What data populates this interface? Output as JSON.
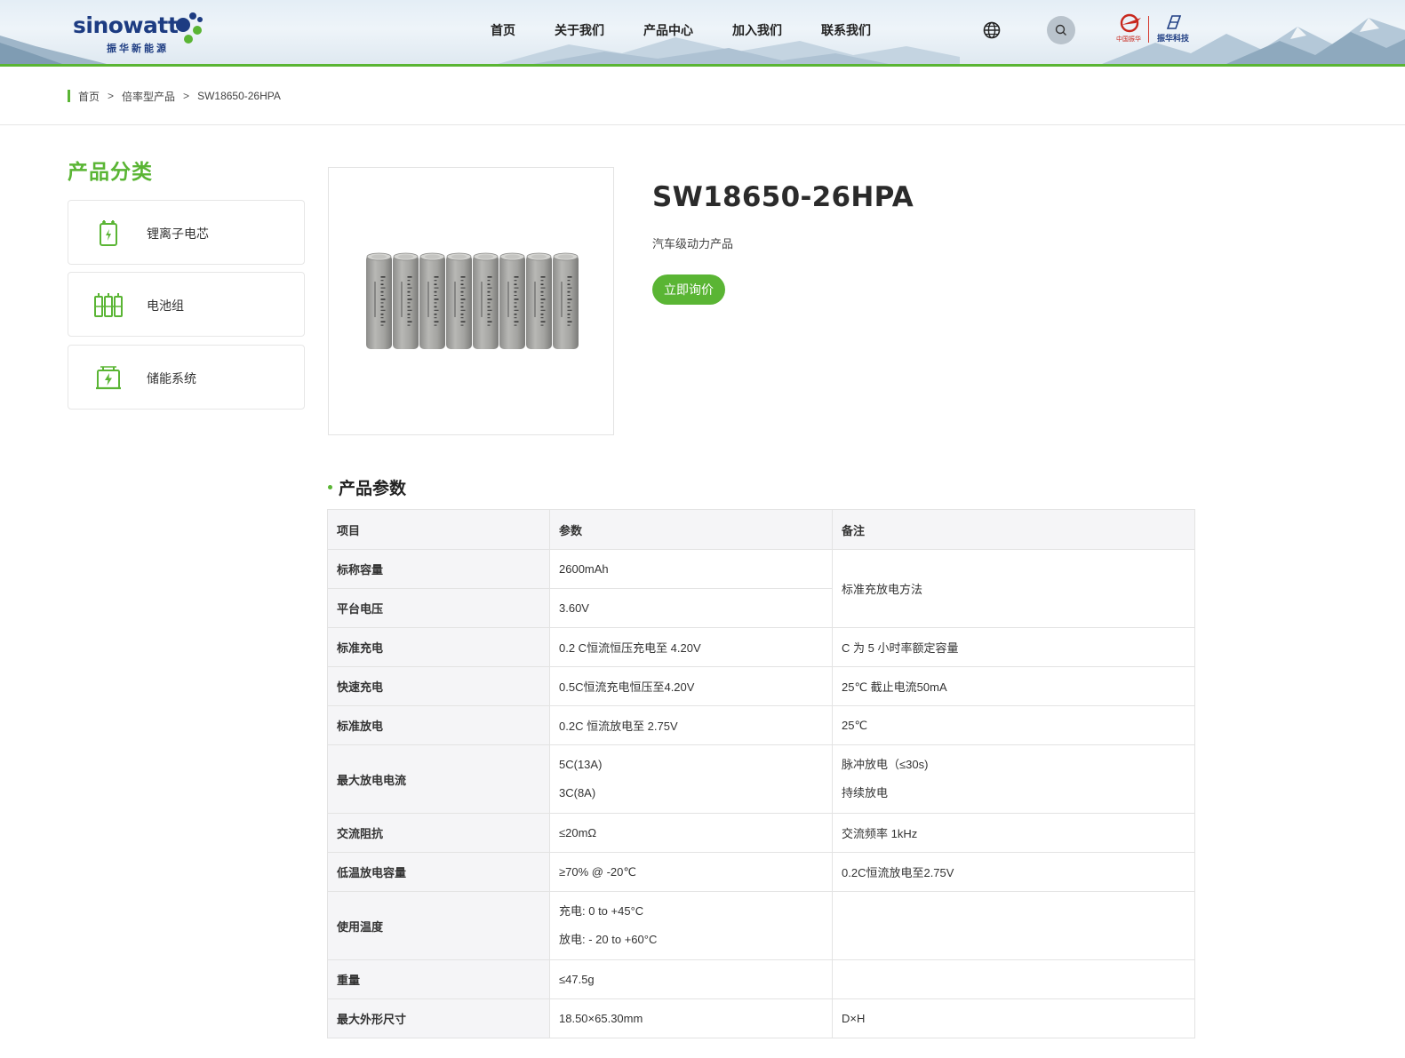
{
  "header": {
    "logo_text": "sinowatt",
    "logo_subtext": "振华新能源",
    "nav": [
      "首页",
      "关于我们",
      "产品中心",
      "加入我们",
      "联系我们"
    ],
    "partner_logo_1": "中国振华",
    "partner_logo_2": "振华科技",
    "icons": [
      "globe-icon",
      "search-icon"
    ],
    "accent_color": "#5ab534"
  },
  "breadcrumb": [
    "首页",
    "倍率型产品",
    "SW18650-26HPA"
  ],
  "sidebar": {
    "title": "产品分类",
    "items": [
      {
        "label": "锂离子电芯",
        "icon": "battery-cell-icon"
      },
      {
        "label": "电池组",
        "icon": "battery-pack-icon"
      },
      {
        "label": "储能系统",
        "icon": "energy-storage-icon"
      }
    ]
  },
  "product": {
    "title": "SW18650-26HPA",
    "subtitle": "汽车级动力产品",
    "inquiry_label": "立即询价",
    "image": "battery-cells-image"
  },
  "params": {
    "title": "产品参数",
    "headers": [
      "项目",
      "参数",
      "备注"
    ],
    "rows": [
      {
        "item": "标称容量",
        "param": [
          "2600mAh"
        ],
        "note": [
          "标准充放电方法"
        ]
      },
      {
        "item": "平台电压",
        "param": [
          "3.60V"
        ],
        "note": []
      },
      {
        "item": "标准充电",
        "param": [
          "0.2 C恒流恒压充电至 4.20V"
        ],
        "note": [
          "C 为 5 小时率额定容量"
        ]
      },
      {
        "item": "快速充电",
        "param": [
          "0.5C恒流充电恒压至4.20V"
        ],
        "note": [
          "25℃ 截止电流50mA"
        ]
      },
      {
        "item": "标准放电",
        "param": [
          "0.2C 恒流放电至 2.75V"
        ],
        "note": [
          "25℃"
        ]
      },
      {
        "item": "最大放电电流",
        "param": [
          "5C(13A)",
          "3C(8A)"
        ],
        "note": [
          "脉冲放电（≤30s)",
          "持续放电"
        ]
      },
      {
        "item": "交流阻抗",
        "param": [
          "≤20mΩ"
        ],
        "note": [
          "交流频率 1kHz"
        ]
      },
      {
        "item": "低温放电容量",
        "param": [
          "≥70% @ -20℃"
        ],
        "note": [
          "0.2C恒流放电至2.75V"
        ]
      },
      {
        "item": "使用温度",
        "param": [
          "充电: 0 to +45°C",
          "放电: - 20 to +60°C"
        ],
        "note": []
      },
      {
        "item": "重量",
        "param": [
          "≤47.5g"
        ],
        "note": []
      },
      {
        "item": "最大外形尺寸",
        "param": [
          "18.50×65.30mm"
        ],
        "note": [
          "D×H"
        ]
      }
    ]
  }
}
